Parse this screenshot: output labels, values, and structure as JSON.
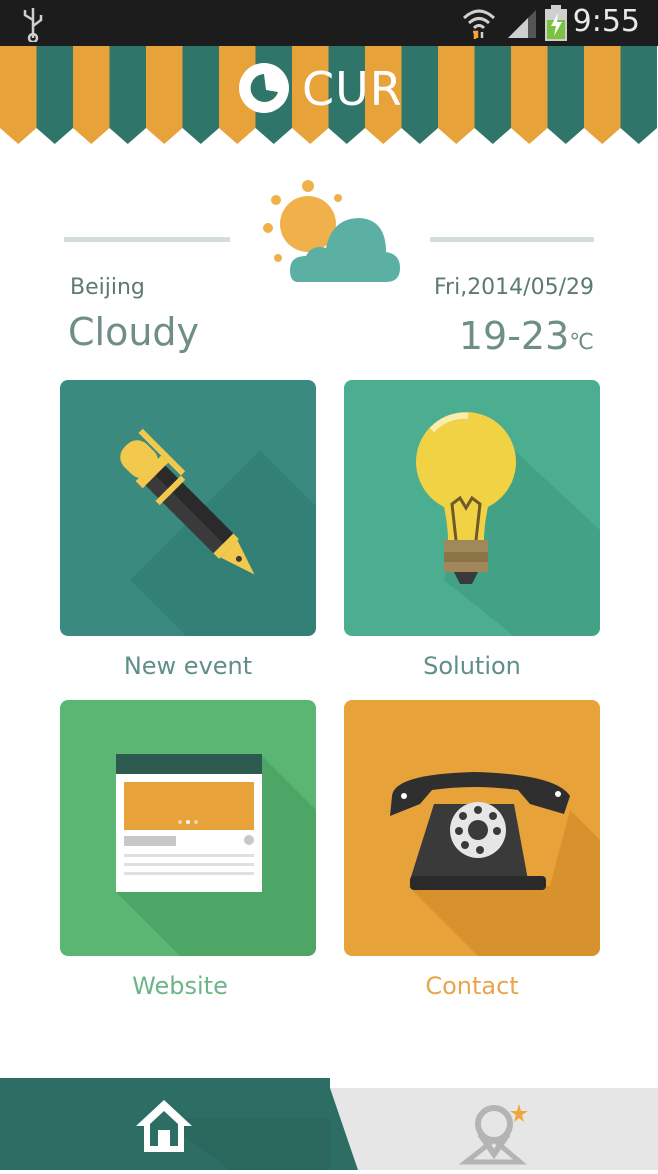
{
  "status_bar": {
    "time": "9:55",
    "icons": [
      "usb-icon",
      "wifi-icon",
      "signal-icon",
      "battery-charging-icon"
    ]
  },
  "header": {
    "logo_text": "CUR",
    "colors": {
      "orange": "#e8a23a",
      "teal": "#2f7569"
    }
  },
  "weather": {
    "city": "Beijing",
    "condition": "Cloudy",
    "date": "Fri,2014/05/29",
    "temp_range": "19-23",
    "temp_unit": "℃",
    "icon": "partly-cloudy-icon"
  },
  "tiles": [
    {
      "label": "New event",
      "icon": "fountain-pen-icon",
      "bg": "#3a8a7f",
      "label_color": "#5f8f87"
    },
    {
      "label": "Solution",
      "icon": "light-bulb-icon",
      "bg": "#4cae90",
      "label_color": "#5f8f87"
    },
    {
      "label": "Website",
      "icon": "web-page-icon",
      "bg": "#5ab672",
      "label_color": "#6db589"
    },
    {
      "label": "Contact",
      "icon": "telephone-icon",
      "bg": "#e8a23a",
      "label_color": "#e8a54a"
    }
  ],
  "bottom_nav": {
    "items": [
      {
        "icon": "home-icon",
        "active": true
      },
      {
        "icon": "location-pin-icon",
        "active": false
      }
    ]
  }
}
